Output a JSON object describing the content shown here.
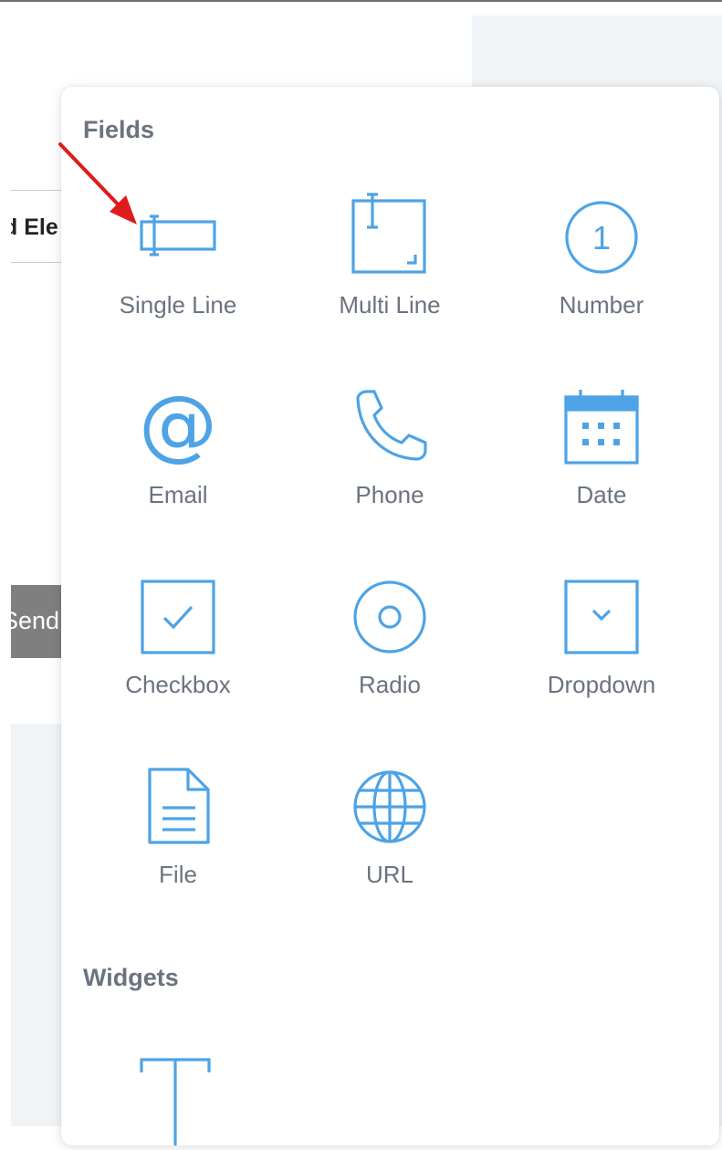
{
  "background": {
    "input_fragment": "d Ele",
    "button_fragment": "Send"
  },
  "popover": {
    "fields_title": "Fields",
    "widgets_title": "Widgets",
    "fields": [
      {
        "label": "Single Line",
        "icon": "single-line-icon"
      },
      {
        "label": "Multi Line",
        "icon": "multi-line-icon"
      },
      {
        "label": "Number",
        "icon": "number-icon",
        "glyph": "1"
      },
      {
        "label": "Email",
        "icon": "email-icon",
        "glyph": "@"
      },
      {
        "label": "Phone",
        "icon": "phone-icon"
      },
      {
        "label": "Date",
        "icon": "calendar-icon"
      },
      {
        "label": "Checkbox",
        "icon": "checkbox-icon"
      },
      {
        "label": "Radio",
        "icon": "radio-icon"
      },
      {
        "label": "Dropdown",
        "icon": "dropdown-icon"
      },
      {
        "label": "File",
        "icon": "file-icon"
      },
      {
        "label": "URL",
        "icon": "globe-icon"
      }
    ],
    "widgets": [
      {
        "icon": "text-widget-icon"
      }
    ]
  },
  "colors": {
    "accent": "#4da3e6",
    "label": "#6b7380",
    "annotation_arrow": "#e01b1b"
  }
}
